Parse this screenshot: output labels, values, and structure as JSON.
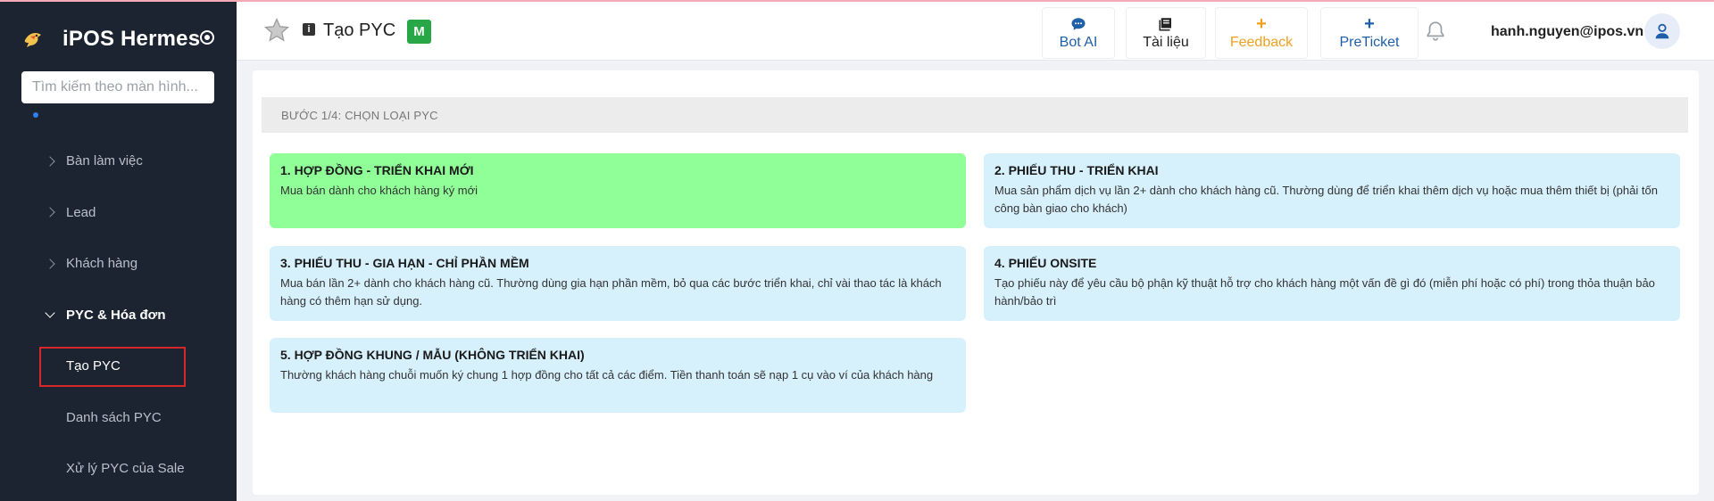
{
  "sidebar": {
    "brand": "iPOS Hermes",
    "search_placeholder": "Tìm kiếm theo màn hình...",
    "items": [
      {
        "label": "Bàn làm việc"
      },
      {
        "label": "Lead"
      },
      {
        "label": "Khách hàng"
      },
      {
        "label": "PYC & Hóa đơn"
      }
    ],
    "subitems": [
      {
        "label": "Tạo PYC"
      },
      {
        "label": "Danh sách PYC"
      },
      {
        "label": "Xử lý PYC của Sale"
      }
    ]
  },
  "header": {
    "title": "Tạo PYC",
    "badge": "M",
    "buttons": [
      {
        "label": "Bot AI",
        "icon": "chat-bubble-icon",
        "color": "#1f5fa8"
      },
      {
        "label": "Tài liệu",
        "icon": "book-icon",
        "color": "#222222"
      },
      {
        "label": "Feedback",
        "icon": "+",
        "color": "#f0a020"
      },
      {
        "label": "PreTicket",
        "icon": "+",
        "color": "#1f5fa8"
      }
    ],
    "user_email": "hanh.nguyen@ipos.vn"
  },
  "main": {
    "step": "BƯỚC 1/4: CHỌN LOẠI PYC",
    "cards": [
      {
        "title": "1. HỢP ĐỒNG - TRIỂN KHAI MỚI",
        "desc": "Mua bán dành cho khách hàng ký mới"
      },
      {
        "title": "2. PHIẾU THU - TRIỂN KHAI",
        "desc": "Mua sản phẩm dịch vụ lần 2+ dành cho khách hàng cũ. Thường dùng để triển khai thêm dịch vụ hoặc mua thêm thiết bị (phải tốn công bàn giao cho khách)"
      },
      {
        "title": "3. PHIẾU THU - GIA HẠN - CHỈ PHẦN MỀM",
        "desc": "Mua bán lần 2+ dành cho khách hàng cũ. Thường dùng gia hạn phần mềm, bỏ qua các bước triển khai, chỉ vài thao tác là khách hàng có thêm hạn sử dụng."
      },
      {
        "title": "4. PHIẾU ONSITE",
        "desc": "Tạo phiếu này để yêu cầu bộ phận kỹ thuật hỗ trợ cho khách hàng một vấn đề gì đó (miễn phí hoặc có phí) trong thỏa thuận bảo hành/bảo trì"
      },
      {
        "title": "5. HỢP ĐỒNG KHUNG / MẪU (KHÔNG TRIỂN KHAI)",
        "desc": "Thường khách hàng chuỗi muốn ký chung 1 hợp đồng cho tất cả các điểm. Tiền thanh toán sẽ nạp 1 cụ vào ví của khách hàng"
      }
    ]
  },
  "colors": {
    "sidebar_bg": "#1c2431",
    "card_selected": "#90ff98",
    "card_default": "#d6f0fc",
    "highlight_border": "#d62828"
  }
}
